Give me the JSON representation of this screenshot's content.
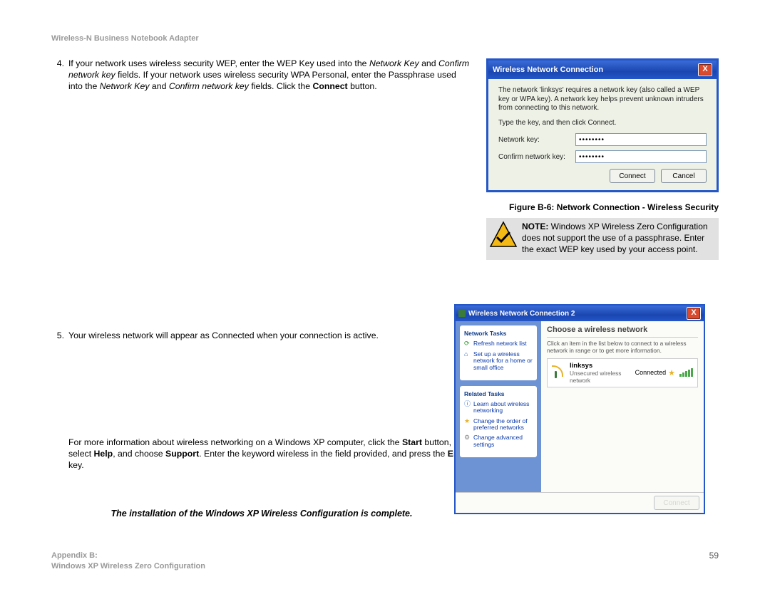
{
  "header": {
    "running": "Wireless-N Business Notebook Adapter"
  },
  "step4": {
    "num": "4.",
    "t1": "If your network uses wireless security WEP, enter the WEP Key used into the ",
    "i1": "Network Key",
    "t2": " and ",
    "i2": "Confirm network key",
    "t3": " fields. If your network uses wireless security WPA Personal, enter the Passphrase used into the ",
    "i3": "Network Key",
    "t4": " and ",
    "i4": "Confirm network key",
    "t5": " fields. Click the ",
    "b1": "Connect",
    "t6": " button."
  },
  "step5": {
    "num": "5.",
    "text": "Your wireless network will appear as Connected when your connection is active."
  },
  "moreinfo": {
    "t1": "For more information about wireless networking on a Windows XP computer, click the ",
    "b1": "Start",
    "t2": " button, select ",
    "b2": "Help",
    "t3": ", and choose ",
    "b3": "Support",
    "t4": ". Enter the keyword wireless in the field provided, and press the ",
    "b4": "Enter",
    "t5": " key."
  },
  "complete": "The installation of the Windows XP Wireless Configuration is complete.",
  "dlg1": {
    "title": "Wireless Network Connection",
    "line1": "The network 'linksys' requires a network key (also called a WEP key or WPA key). A network key helps prevent unknown intruders from connecting to this network.",
    "line2": "Type the key, and then click Connect.",
    "label_key": "Network key:",
    "label_confirm": "Confirm network key:",
    "val_key": "••••••••",
    "val_confirm": "••••••••",
    "btn_connect": "Connect",
    "btn_cancel": "Cancel",
    "close": "X"
  },
  "figcap": "Figure B-6: Network Connection - Wireless Security",
  "note": {
    "b": "NOTE:",
    "text": "  Windows XP Wireless Zero Configuration does not support the use of a passphrase. Enter the exact WEP key used by your access point."
  },
  "dlg2": {
    "title": "Wireless Network Connection 2",
    "close": "X",
    "side_h1": "Network Tasks",
    "task1": "Refresh network list",
    "task2": "Set up a wireless network for a home or small office",
    "side_h2": "Related Tasks",
    "task3": "Learn about wireless networking",
    "task4": "Change the order of preferred networks",
    "task5": "Change advanced settings",
    "main_h": "Choose a wireless network",
    "instr": "Click an item in the list below to connect to a wireless network in range or to get more information.",
    "net_name": "linksys",
    "net_sub": "Unsecured wireless network",
    "net_status": "Connected",
    "btn_connect": "Connect"
  },
  "footer": {
    "l1": "Appendix B:",
    "l2": "Windows XP Wireless Zero Configuration",
    "page": "59"
  }
}
